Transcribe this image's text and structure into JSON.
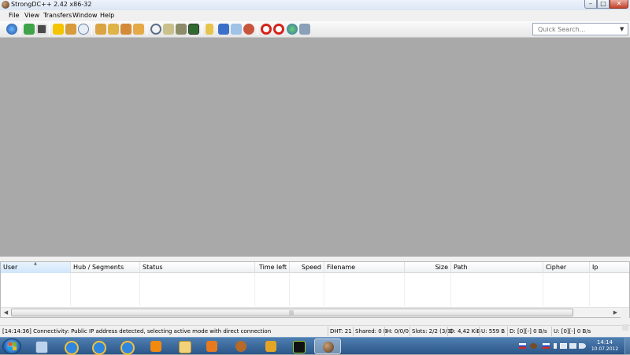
{
  "window": {
    "title": "StrongDC++ 2.42 x86-32",
    "controls": {
      "minimize": "–",
      "maximize": "□",
      "close": "✕"
    }
  },
  "menu": [
    "File",
    "View",
    "Transfers",
    "Window",
    "Help"
  ],
  "toolbar": {
    "icons": [
      "connect-icon",
      "reconnect-icon",
      "follow-redirect-icon",
      "favorite-hubs-icon",
      "favorite-users-icon",
      "recent-hubs-icon",
      "queue-icon",
      "finished-downloads-icon",
      "waiting-users-icon",
      "finished-uploads-icon",
      "search-icon",
      "adl-search-icon",
      "search-spy-icon",
      "network-stats-icon",
      "open-filelist-icon",
      "settings-icon",
      "notepad-icon",
      "refresh-share-icon",
      "cdm-debug-icon",
      "limit-upload-icon",
      "limit-download-icon",
      "away-icon",
      "about-icon"
    ],
    "quick_search_placeholder": "Quick Search..."
  },
  "transfers": {
    "columns": [
      "User",
      "Hub / Segments",
      "Status",
      "Time left",
      "Speed",
      "Filename",
      "Size",
      "Path",
      "Cipher",
      "Ip"
    ],
    "scroll_grip": "|||"
  },
  "status": {
    "message": "[14:14:36] Connectivity: Public IP address detected, selecting active mode with direct connection",
    "dht": "DHT: 21",
    "shared": "Shared: 0 B",
    "hubs": "H: 0/0/0",
    "slots": "Slots: 2/2 (3/3)",
    "downloaded": "D: 4,42 KiB",
    "uploaded": "U: 559 B",
    "down_speed": "D: [0][-] 0 B/s",
    "up_speed": "U: [0][-] 0 B/s"
  },
  "taskbar": {
    "apps": [
      "windows-explorer-icon",
      "internet-explorer-icon",
      "internet-explorer-icon-2",
      "internet-explorer-icon-3",
      "odnoklassniki-icon",
      "folder-icon",
      "media-player-icon",
      "aimp-player-icon",
      "paint-tool-icon",
      "game-launcher-icon",
      "strongdc-icon"
    ],
    "clock_time": "14:14",
    "clock_date": "10.07.2012"
  }
}
